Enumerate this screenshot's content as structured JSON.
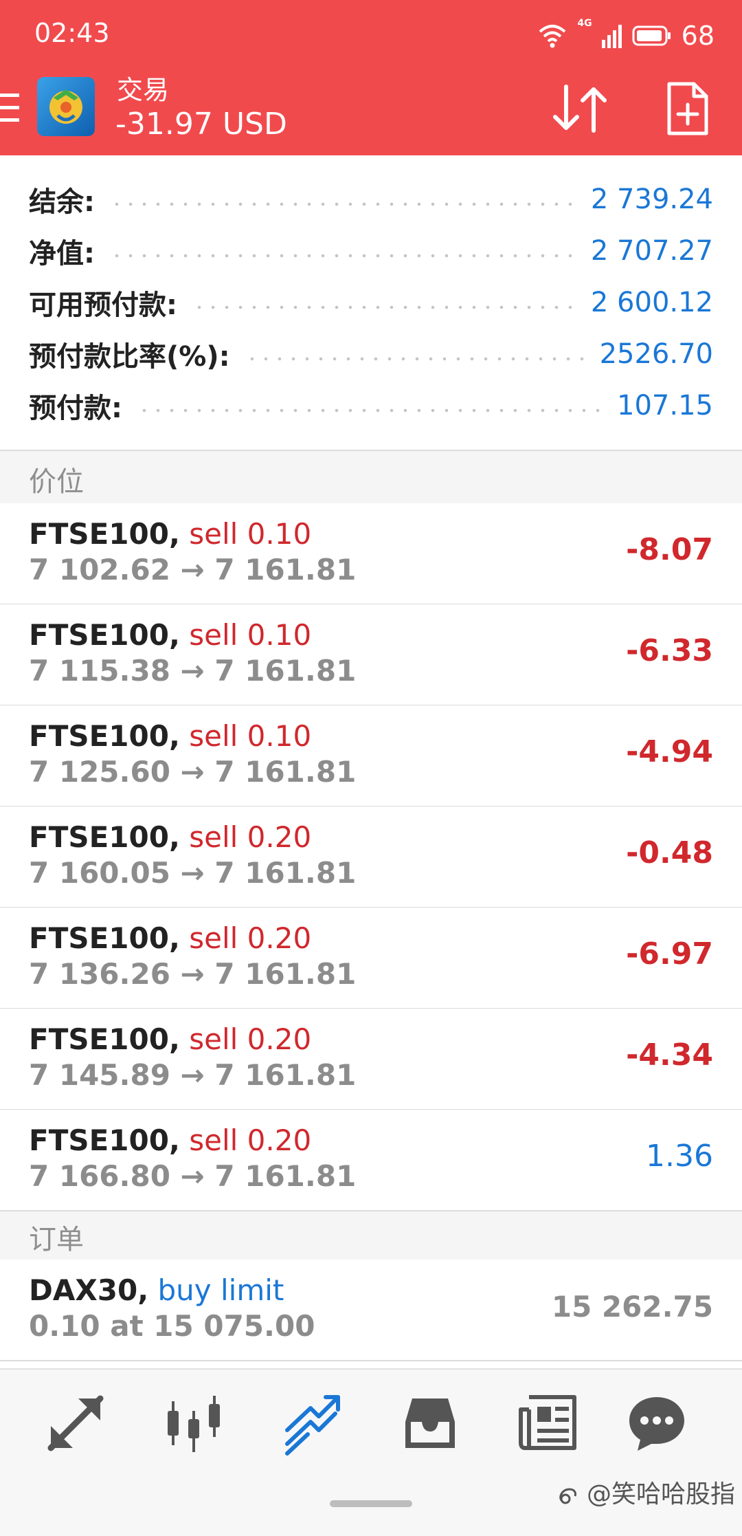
{
  "status_bar": {
    "time": "02:43",
    "network": "4G",
    "battery": "68"
  },
  "header": {
    "title": "交易",
    "balance": "-31.97 USD",
    "color": "#f14a4d"
  },
  "summary": [
    {
      "label": "结余:",
      "value": "2 739.24"
    },
    {
      "label": "净值:",
      "value": "2 707.27"
    },
    {
      "label": "可用预付款:",
      "value": "2 600.12"
    },
    {
      "label": "预付款比率(%):",
      "value": "2526.70"
    },
    {
      "label": "预付款:",
      "value": "107.15"
    }
  ],
  "positions_header": "价位",
  "positions": [
    {
      "symbol": "FTSE100,",
      "side": "sell 0.10",
      "open": "7 102.62",
      "arrow": "→",
      "current": "7 161.81",
      "profit": "-8.07"
    },
    {
      "symbol": "FTSE100,",
      "side": "sell 0.10",
      "open": "7 115.38",
      "arrow": "→",
      "current": "7 161.81",
      "profit": "-6.33"
    },
    {
      "symbol": "FTSE100,",
      "side": "sell 0.10",
      "open": "7 125.60",
      "arrow": "→",
      "current": "7 161.81",
      "profit": "-4.94"
    },
    {
      "symbol": "FTSE100,",
      "side": "sell 0.20",
      "open": "7 160.05",
      "arrow": "→",
      "current": "7 161.81",
      "profit": "-0.48"
    },
    {
      "symbol": "FTSE100,",
      "side": "sell 0.20",
      "open": "7 136.26",
      "arrow": "→",
      "current": "7 161.81",
      "profit": "-6.97"
    },
    {
      "symbol": "FTSE100,",
      "side": "sell 0.20",
      "open": "7 145.89",
      "arrow": "→",
      "current": "7 161.81",
      "profit": "-4.34"
    },
    {
      "symbol": "FTSE100,",
      "side": "sell 0.20",
      "open": "7 166.80",
      "arrow": "→",
      "current": "7 161.81",
      "profit": "1.36"
    }
  ],
  "orders_header": "订单",
  "orders": [
    {
      "symbol": "DAX30,",
      "type": "buy limit",
      "detail": "0.10 at 15 075.00",
      "price": "15 262.75"
    }
  ],
  "bottom_nav": {
    "items": [
      "quotes-icon",
      "chart-icon",
      "trade-icon",
      "history-icon",
      "news-icon",
      "messages-icon"
    ],
    "active": "trade-icon"
  },
  "watermark": "@笑哈哈股指",
  "colors": {
    "accent": "#1a77d6",
    "negative": "#d0282d",
    "muted": "#8c8c8c"
  }
}
